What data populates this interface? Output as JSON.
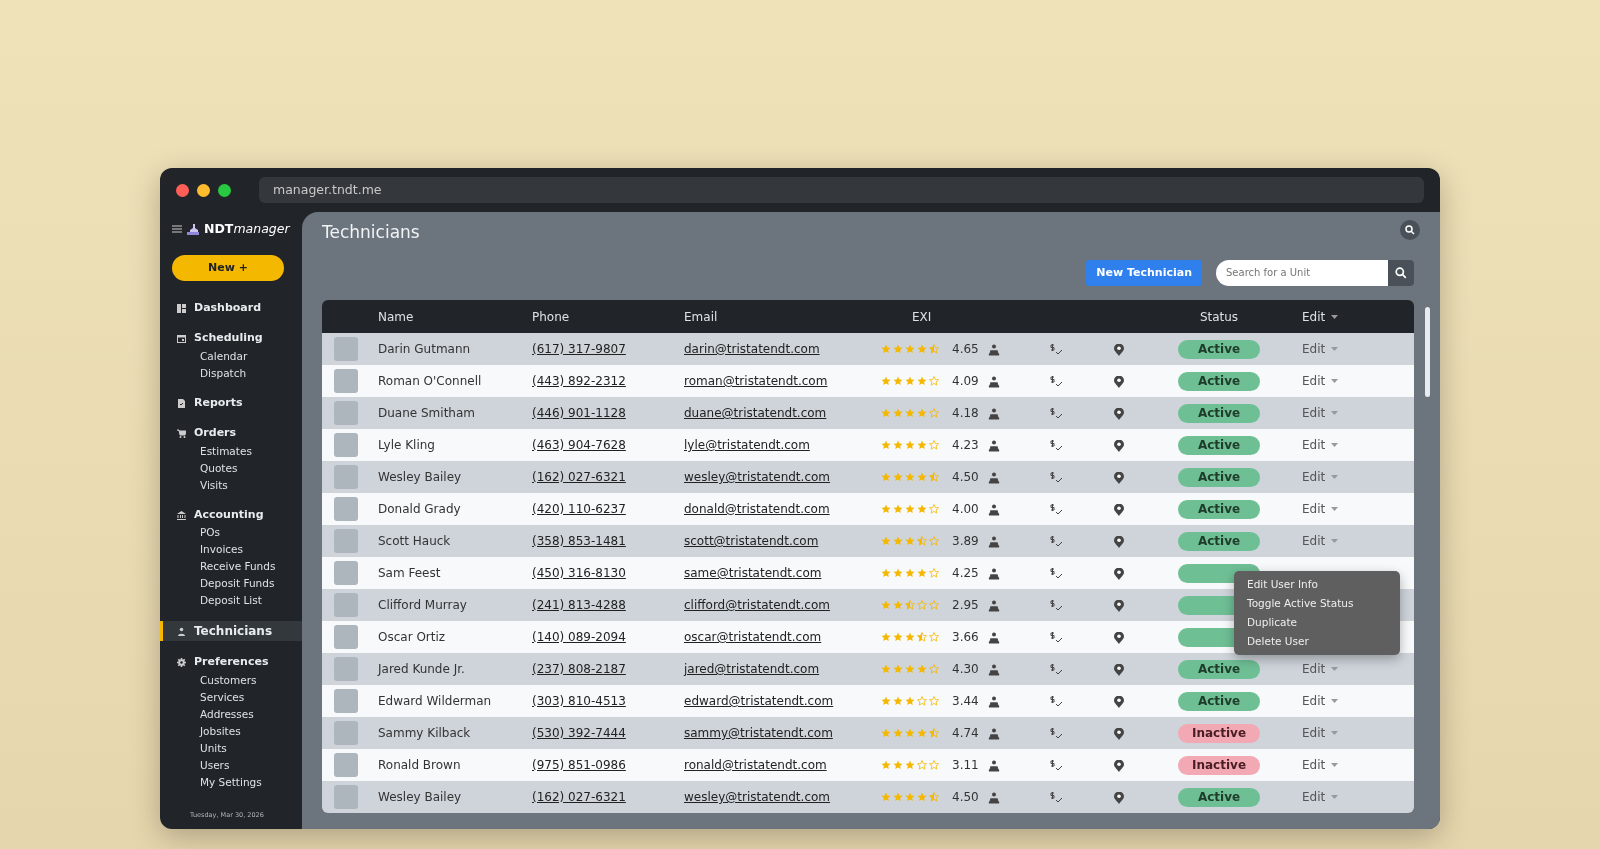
{
  "browser": {
    "address": "manager.tndt.me"
  },
  "sidebar": {
    "logo_bold": "NDT",
    "logo_italic": "manager",
    "new_button": "New +",
    "items": [
      {
        "label": "Dashboard",
        "selected": false
      },
      {
        "label": "Scheduling",
        "selected": false,
        "children": [
          {
            "label": "Calendar"
          },
          {
            "label": "Dispatch"
          }
        ]
      },
      {
        "label": "Reports",
        "selected": false
      },
      {
        "label": "Orders",
        "selected": false,
        "children": [
          {
            "label": "Estimates"
          },
          {
            "label": "Quotes"
          },
          {
            "label": "Visits"
          }
        ]
      },
      {
        "label": "Accounting",
        "selected": false,
        "children": [
          {
            "label": "POs"
          },
          {
            "label": "Invoices"
          },
          {
            "label": "Receive Funds"
          },
          {
            "label": "Deposit Funds"
          },
          {
            "label": "Deposit List"
          }
        ]
      },
      {
        "label": "Technicians",
        "selected": true
      },
      {
        "label": "Preferences",
        "selected": false,
        "children": [
          {
            "label": "Customers"
          },
          {
            "label": "Services"
          },
          {
            "label": "Addresses"
          },
          {
            "label": "Jobsites"
          },
          {
            "label": "Units"
          },
          {
            "label": "Users"
          },
          {
            "label": "My Settings"
          }
        ]
      }
    ],
    "date": "Tuesday, Mar 30, 2026"
  },
  "page": {
    "title": "Technicians",
    "new_button": "New Technician",
    "search": {
      "placeholder": "Search for a Unit"
    }
  },
  "table": {
    "columns": [
      "Name",
      "Phone",
      "Email",
      "EXI",
      "Status",
      "Edit"
    ],
    "rows": [
      {
        "name": "Darin Gutmann",
        "phone": "(617) 317-9807",
        "email": "darin@tristatendt.com",
        "stars": 4.5,
        "exi": "4.65",
        "status": "Active",
        "active": true,
        "edit": "Edit"
      },
      {
        "name": "Roman O'Connell",
        "phone": "(443) 892-2312",
        "email": "roman@tristatendt.com",
        "stars": 4,
        "exi": "4.09",
        "status": "Active",
        "active": true,
        "edit": "Edit"
      },
      {
        "name": "Duane Smitham",
        "phone": "(446) 901-1128",
        "email": "duane@tristatendt.com",
        "stars": 4,
        "exi": "4.18",
        "status": "Active",
        "active": true,
        "edit": "Edit"
      },
      {
        "name": "Lyle Kling",
        "phone": "(463) 904-7628",
        "email": "lyle@tristatendt.com",
        "stars": 4,
        "exi": "4.23",
        "status": "Active",
        "active": true,
        "edit": "Edit"
      },
      {
        "name": "Wesley Bailey",
        "phone": "(162) 027-6321",
        "email": "wesley@tristatendt.com",
        "stars": 4.5,
        "exi": "4.50",
        "status": "Active",
        "active": true,
        "edit": "Edit"
      },
      {
        "name": "Donald Grady",
        "phone": "(420) 110-6237",
        "email": "donald@tristatendt.com",
        "stars": 4,
        "exi": "4.00",
        "status": "Active",
        "active": true,
        "edit": "Edit"
      },
      {
        "name": "Scott Hauck",
        "phone": "(358) 853-1481",
        "email": "scott@tristatendt.com",
        "stars": 3.5,
        "exi": "3.89",
        "status": "Active",
        "active": true,
        "edit": "Edit"
      },
      {
        "name": "Sam Feest",
        "phone": "(450) 316-8130",
        "email": "same@tristatendt.com",
        "stars": 4,
        "exi": "4.25",
        "active": true,
        "menu_open": true
      },
      {
        "name": "Clifford Murray",
        "phone": "(241) 813-4288",
        "email": "clifford@tristatendt.com",
        "stars": 2.5,
        "exi": "2.95",
        "active": true
      },
      {
        "name": "Oscar Ortiz",
        "phone": "(140) 089-2094",
        "email": "oscar@tristatendt.com",
        "stars": 3.5,
        "exi": "3.66",
        "active": true
      },
      {
        "name": "Jared Kunde Jr.",
        "phone": "(237) 808-2187",
        "email": "jared@tristatendt.com",
        "stars": 4,
        "exi": "4.30",
        "status": "Active",
        "active": true,
        "edit": "Edit"
      },
      {
        "name": "Edward Wilderman",
        "phone": "(303) 810-4513",
        "email": "edward@tristatendt.com",
        "stars": 3,
        "exi": "3.44",
        "status": "Active",
        "active": true,
        "edit": "Edit"
      },
      {
        "name": "Sammy Kilback",
        "phone": "(530) 392-7444",
        "email": "sammy@tristatendt.com",
        "stars": 4.5,
        "exi": "4.74",
        "status": "Inactive",
        "active": false,
        "edit": "Edit"
      },
      {
        "name": "Ronald Brown",
        "phone": "(975) 851-0986",
        "email": "ronald@tristatendt.com",
        "stars": 3,
        "exi": "3.11",
        "status": "Inactive",
        "active": false,
        "edit": "Edit"
      },
      {
        "name": "Wesley Bailey",
        "phone": "(162) 027-6321",
        "email": "wesley@tristatendt.com",
        "stars": 4.5,
        "exi": "4.50",
        "status": "Active",
        "active": true,
        "edit": "Edit"
      }
    ]
  },
  "edit_menu": {
    "items": [
      "Edit User Info",
      "Toggle Active Status",
      "Duplicate",
      "Delete User"
    ]
  }
}
